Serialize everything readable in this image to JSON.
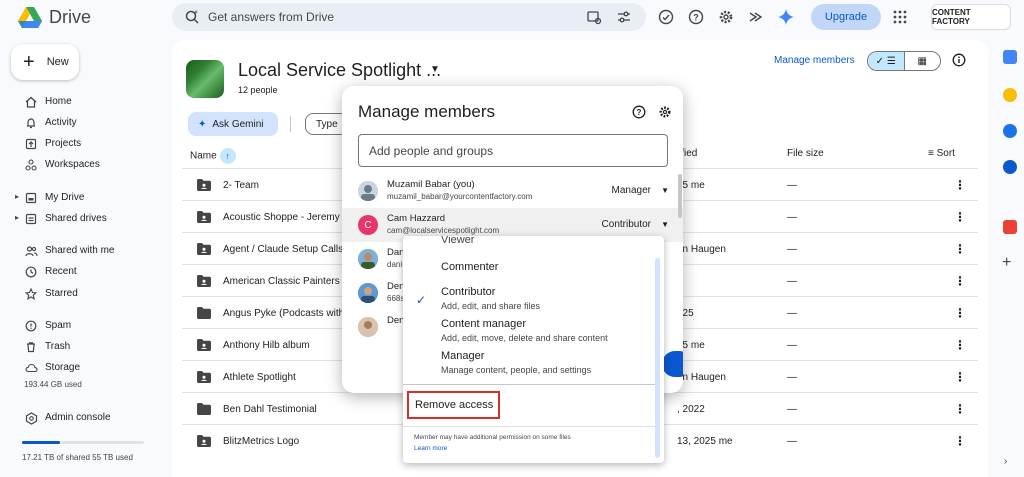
{
  "app": {
    "name": "Drive",
    "colors": {
      "accent": "#0b57d0",
      "highlight_border": "#d93025"
    }
  },
  "search": {
    "placeholder": "Get answers from Drive"
  },
  "topbar": {
    "upgrade_label": "Upgrade",
    "account_label": "CONTENT FACTORY"
  },
  "sidebar": {
    "new_label": "New",
    "items": [
      {
        "label": "Home",
        "icon": "home-icon"
      },
      {
        "label": "Activity",
        "icon": "bell-icon"
      },
      {
        "label": "Projects",
        "icon": "projects-icon"
      },
      {
        "label": "Workspaces",
        "icon": "workspaces-icon"
      },
      {
        "label": "My Drive",
        "icon": "my-drive-icon"
      },
      {
        "label": "Shared drives",
        "icon": "shared-drives-icon"
      },
      {
        "label": "Shared with me",
        "icon": "people-icon"
      },
      {
        "label": "Recent",
        "icon": "clock-icon"
      },
      {
        "label": "Starred",
        "icon": "star-icon"
      },
      {
        "label": "Spam",
        "icon": "spam-icon"
      },
      {
        "label": "Trash",
        "icon": "trash-icon"
      },
      {
        "label": "Storage",
        "icon": "cloud-icon"
      }
    ],
    "storage_used": "193.44 GB used",
    "admin_label": "Admin console",
    "quota_text": "17.21 TB of shared 55 TB used",
    "quota_fraction": 0.31
  },
  "folder": {
    "title": "Local Service Spotlight ...",
    "people": "12 people",
    "manage_members_link": "Manage members"
  },
  "filters": {
    "gemini_label": "Ask Gemini",
    "type_label": "Type"
  },
  "table": {
    "headers": {
      "name": "Name",
      "modified": "ified",
      "size": "File size",
      "sort": "Sort"
    },
    "rows": [
      {
        "name": "2- Team",
        "modified": "25 me",
        "size": "—"
      },
      {
        "name": "Acoustic Shoppe - Jeremy",
        "modified": "",
        "size": "—"
      },
      {
        "name": "Agent / Claude Setup Calls",
        "modified": "an Haugen",
        "size": "—"
      },
      {
        "name": "American Classic Painters -",
        "modified": "",
        "size": "—"
      },
      {
        "name": "Angus Pyke (Podcasts with",
        "modified": "025",
        "size": "—"
      },
      {
        "name": "Anthony Hilb album",
        "modified": "25 me",
        "size": "—"
      },
      {
        "name": "Athlete Spotlight",
        "modified": "an Haugen",
        "size": "—"
      },
      {
        "name": "Ben Dahl Testimonial",
        "modified": ", 2022",
        "size": "—"
      },
      {
        "name": "BlitzMetrics Logo",
        "modified": "13, 2025 me",
        "size": "—"
      }
    ]
  },
  "dialog": {
    "title": "Manage members",
    "add_placeholder": "Add people and groups",
    "members": [
      {
        "name": "Muzamil Babar (you)",
        "email": "muzamil_babar@yourcontentfactory.com",
        "role": "Manager",
        "initial": ""
      },
      {
        "name": "Cam Hazzard",
        "email": "cam@localservicespotlight.com",
        "role": "Contributor",
        "initial": "C"
      },
      {
        "name": "Dan",
        "email": "dani",
        "role": "",
        "initial": ""
      },
      {
        "name": "Den",
        "email": "668s",
        "role": "",
        "initial": ""
      },
      {
        "name": "Den",
        "email": "",
        "role": "",
        "initial": ""
      }
    ]
  },
  "role_menu": {
    "peek_label": "Viewer",
    "options": [
      {
        "label": "Commenter",
        "desc": ""
      },
      {
        "label": "Contributor",
        "desc": "Add, edit, and share files",
        "selected": true
      },
      {
        "label": "Content manager",
        "desc": "Add, edit, move, delete and share content"
      },
      {
        "label": "Manager",
        "desc": "Manage content, people, and settings"
      }
    ],
    "remove_label": "Remove access",
    "note": "Member may have additional permission on some files",
    "learn_more": "Learn more"
  }
}
